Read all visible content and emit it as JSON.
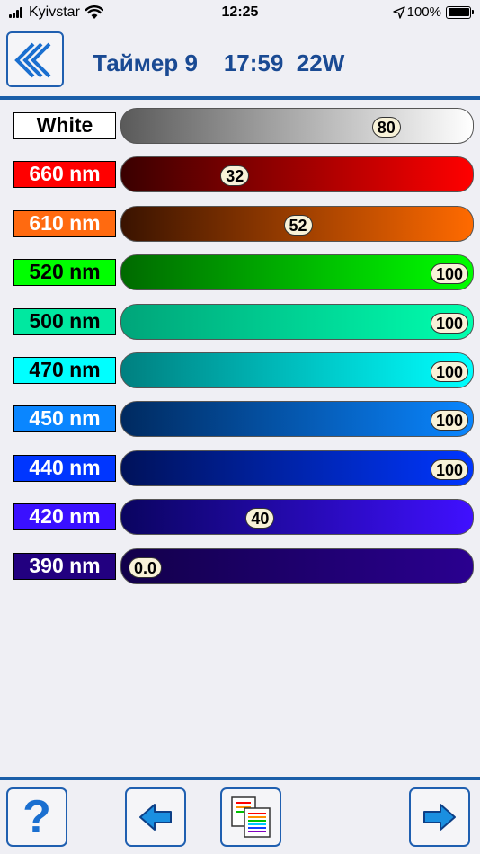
{
  "status_bar": {
    "carrier": "Kyivstar",
    "time": "12:25",
    "battery": "100%"
  },
  "header": {
    "title": "Таймер 9    17:59  22W",
    "back_icon": "double-chevron-left-icon"
  },
  "channels": [
    {
      "label": "White",
      "value": "80",
      "level": 80,
      "label_bg": "#ffffff",
      "label_fg": "#000000",
      "grad_from": "#5a5a5a",
      "grad_to": "#ffffff"
    },
    {
      "label": "660 nm",
      "value": "32",
      "level": 32,
      "label_bg": "#ff0000",
      "label_fg": "#ffffff",
      "grad_from": "#3a0000",
      "grad_to": "#ff0000"
    },
    {
      "label": "610 nm",
      "value": "52",
      "level": 52,
      "label_bg": "#ff6a10",
      "label_fg": "#ffffff",
      "grad_from": "#3a1300",
      "grad_to": "#ff6a00"
    },
    {
      "label": "520 nm",
      "value": "100",
      "level": 100,
      "label_bg": "#00ff00",
      "label_fg": "#000000",
      "grad_from": "#006a00",
      "grad_to": "#00ff00"
    },
    {
      "label": "500 nm",
      "value": "100",
      "level": 100,
      "label_bg": "#00e8a0",
      "label_fg": "#000000",
      "grad_from": "#00a57a",
      "grad_to": "#00ffae"
    },
    {
      "label": "470 nm",
      "value": "100",
      "level": 100,
      "label_bg": "#00ffff",
      "label_fg": "#000000",
      "grad_from": "#008080",
      "grad_to": "#00ffff"
    },
    {
      "label": "450 nm",
      "value": "100",
      "level": 100,
      "label_bg": "#0a86ff",
      "label_fg": "#ffffff",
      "grad_from": "#002a60",
      "grad_to": "#0a86ff"
    },
    {
      "label": "440 nm",
      "value": "100",
      "level": 100,
      "label_bg": "#0036ff",
      "label_fg": "#ffffff",
      "grad_from": "#00125a",
      "grad_to": "#0036ff"
    },
    {
      "label": "420 nm",
      "value": "40",
      "level": 40,
      "label_bg": "#3a10ff",
      "label_fg": "#ffffff",
      "grad_from": "#0a0460",
      "grad_to": "#4010ff"
    },
    {
      "label": "390 nm",
      "value": "0.0",
      "level": 0,
      "label_bg": "#220080",
      "label_fg": "#ffffff",
      "grad_from": "#12004a",
      "grad_to": "#2a0090"
    }
  ],
  "toolbar": {
    "help_label": "?",
    "help_icon": "question-icon",
    "prev_icon": "arrow-left-icon",
    "copy_icon": "copy-documents-icon",
    "next_icon": "arrow-right-icon"
  },
  "colors": {
    "accent": "#1a5ea8",
    "title": "#1a4a93",
    "background": "#efeff4",
    "value_badge": "#f8f2d8"
  }
}
